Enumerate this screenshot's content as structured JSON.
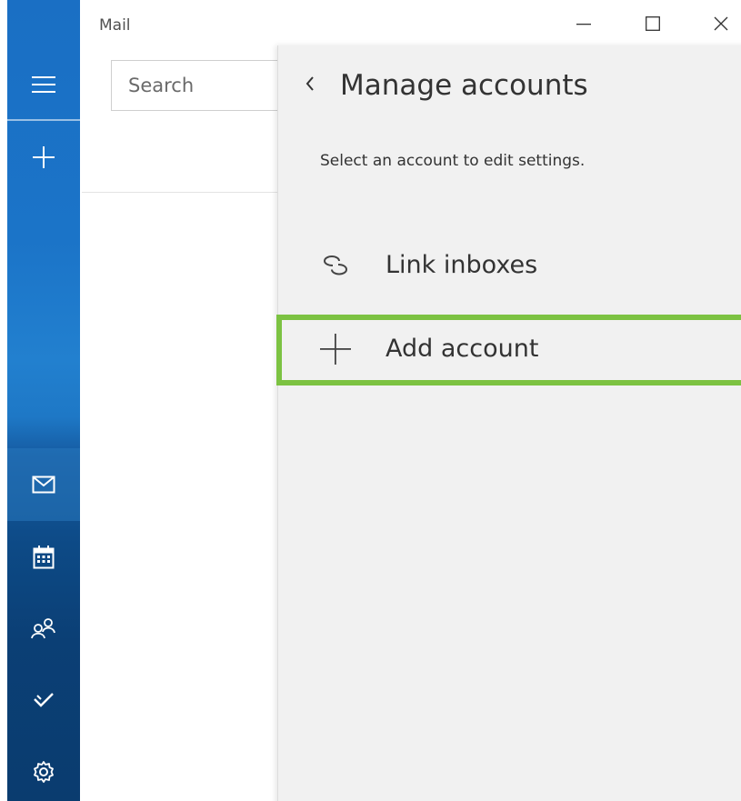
{
  "window": {
    "title": "Mail",
    "controls": {
      "minimize": "minimize-icon",
      "maximize": "maximize-icon",
      "close": "close-icon"
    }
  },
  "nav_rail": {
    "top_buttons": [
      {
        "name": "hamburger-menu",
        "icon": "menu-icon"
      },
      {
        "name": "new-mail",
        "icon": "plus-icon"
      }
    ],
    "bottom_buttons": [
      {
        "name": "mail",
        "icon": "mail-icon",
        "selected": true
      },
      {
        "name": "calendar",
        "icon": "calendar-icon"
      },
      {
        "name": "people",
        "icon": "people-icon"
      },
      {
        "name": "todo",
        "icon": "checkmark-icon"
      },
      {
        "name": "settings",
        "icon": "gear-icon"
      }
    ]
  },
  "search": {
    "placeholder": "Search",
    "value": ""
  },
  "manage_accounts": {
    "title": "Manage accounts",
    "description": "Select an account to edit settings.",
    "items": [
      {
        "label": "Link inboxes",
        "icon": "link-icon",
        "highlighted": false
      },
      {
        "label": "Add account",
        "icon": "plus-icon",
        "highlighted": true
      }
    ]
  },
  "colors": {
    "rail_top": "#1a6fc4",
    "rail_bottom": "#0a3c6f",
    "panel_background": "#f1f1f1",
    "highlight_border": "#7cc242",
    "text_primary": "#333333"
  }
}
